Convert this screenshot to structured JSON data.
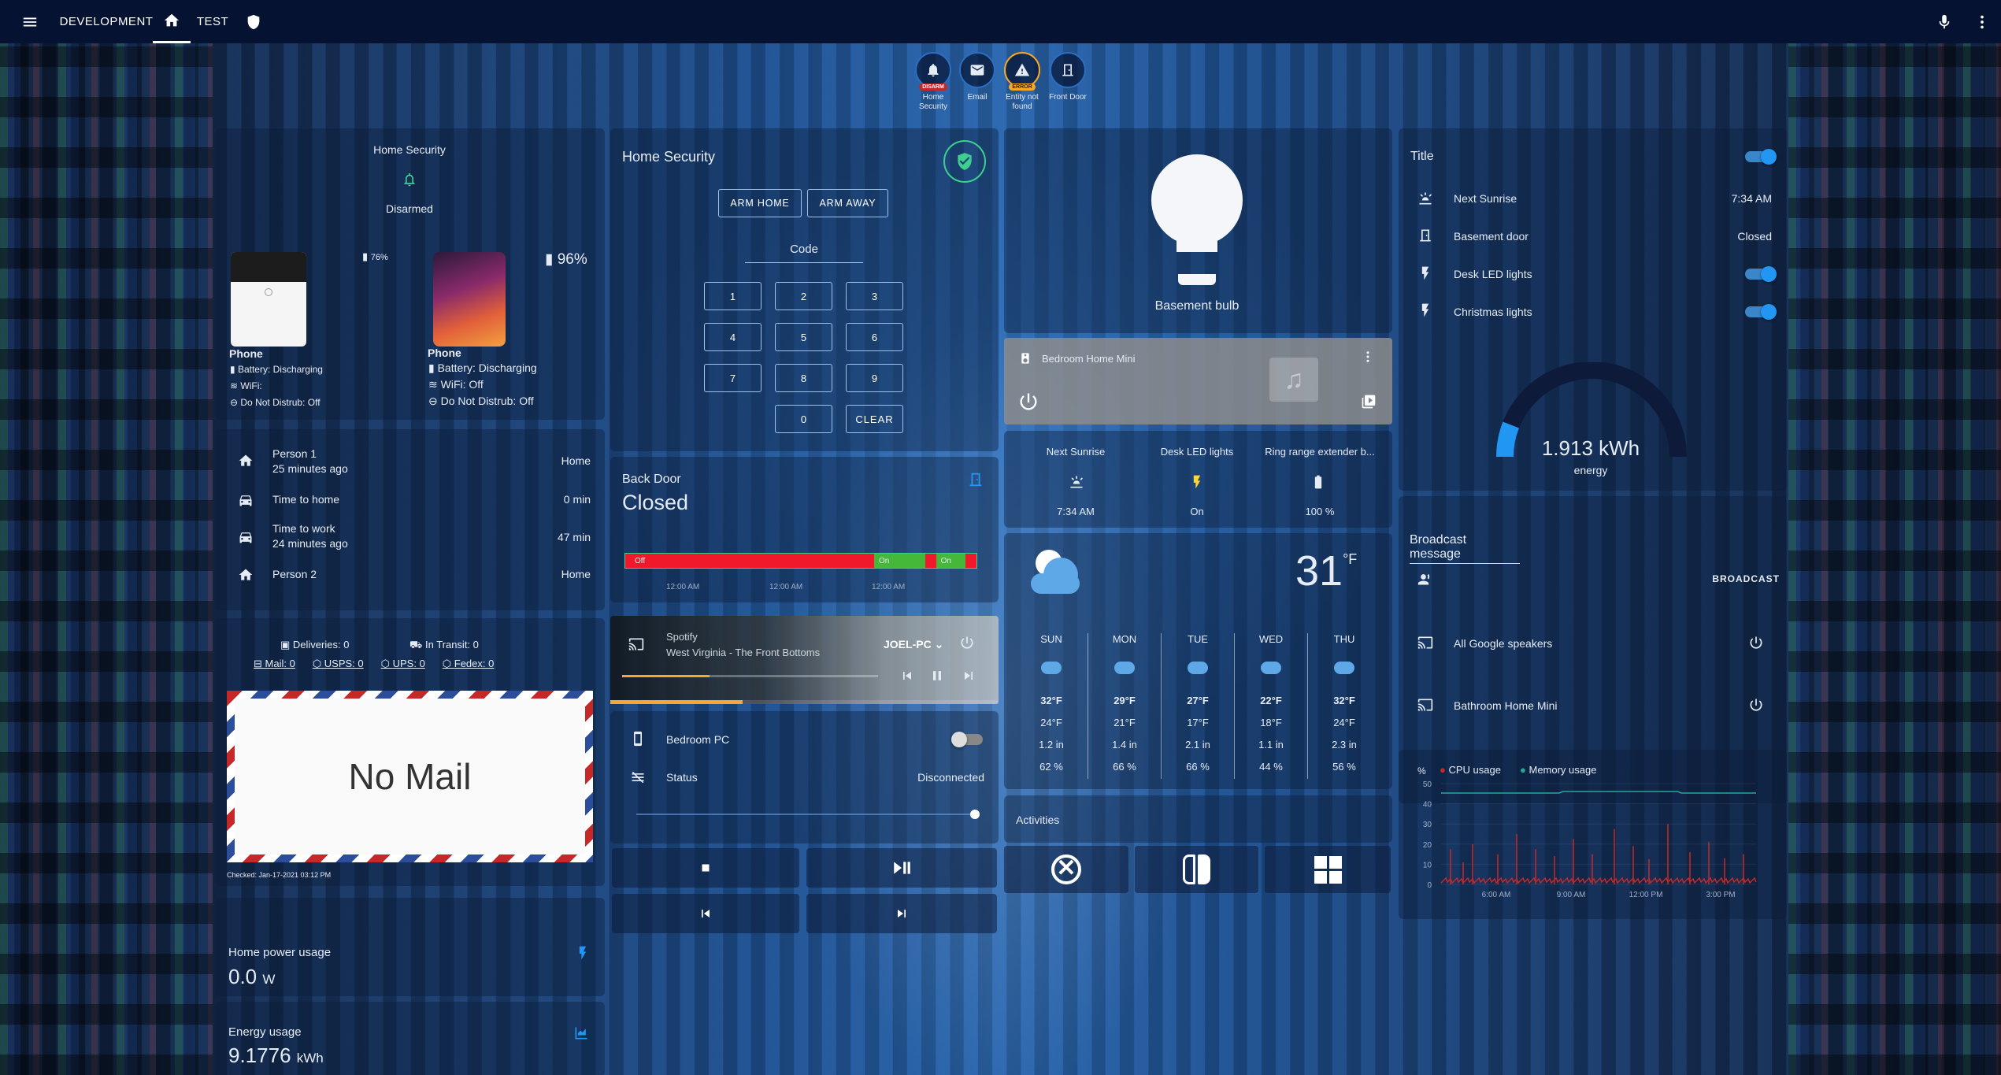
{
  "topbar": {
    "tabs": [
      "DEVELOPMENT",
      "TEST"
    ]
  },
  "badges": [
    {
      "label": "Home Security",
      "chip": "DISARM",
      "chip_color": "#c62828"
    },
    {
      "label": "Email",
      "chip": ""
    },
    {
      "label": "Entity not found",
      "chip": "ERROR",
      "chip_color": "#f9a825"
    },
    {
      "label": "Front Door",
      "chip": ""
    }
  ],
  "alarm_glance": {
    "title": "Home Security",
    "state": "Disarmed"
  },
  "phones": [
    {
      "name": "Phone",
      "battery": "76%",
      "status": "Battery: Discharging",
      "wifi": "WiFi:",
      "dnd": "Do Not Distrub: Off"
    },
    {
      "name": "Phone",
      "battery": "96%",
      "status": "Battery: Discharging",
      "wifi": "WiFi: Off",
      "dnd": "Do Not Distrub: Off"
    }
  ],
  "people": [
    {
      "name": "Person 1",
      "sub": "25 minutes ago",
      "value": "Home"
    },
    {
      "name": "Time to home",
      "sub": "",
      "value": "0 min"
    },
    {
      "name": "Time to work",
      "sub": "24 minutes ago",
      "value": "47 min"
    },
    {
      "name": "Person 2",
      "sub": "",
      "value": "Home"
    }
  ],
  "mail": {
    "deliveries": "Deliveries: 0",
    "in_transit": "In Transit: 0",
    "mail": "Mail: 0",
    "usps": "USPS: 0",
    "ups": "UPS: 0",
    "fedex": "Fedex: 0",
    "envelope": "No Mail",
    "checked": "Checked: Jan-17-2021 03:12 PM"
  },
  "power": {
    "label": "Home power usage",
    "value": "0.0",
    "unit": "W"
  },
  "energy": {
    "label": "Energy usage",
    "value": "9.1776",
    "unit": "kWh"
  },
  "alarm": {
    "title": "Home Security",
    "arm_home": "ARM HOME",
    "arm_away": "ARM AWAY",
    "code_label": "Code",
    "keys": [
      "1",
      "2",
      "3",
      "4",
      "5",
      "6",
      "7",
      "8",
      "9",
      "0"
    ],
    "clear": "CLEAR"
  },
  "back_door": {
    "label": "Back Door",
    "state": "Closed",
    "segments": [
      {
        "label": "Off",
        "fraction": 0.67
      },
      {
        "label": "On",
        "fraction": 0.13
      },
      {
        "label": "On",
        "fraction": 0.07
      }
    ],
    "times": [
      "12:00 AM",
      "12:00 AM",
      "12:00 AM"
    ]
  },
  "spotify": {
    "source": "Spotify",
    "track": "West Virginia - The Front Bottoms",
    "device": "JOEL-PC",
    "progress": 0.34
  },
  "pc": {
    "name": "Bedroom PC",
    "status_label": "Status",
    "status": "Disconnected",
    "volume": 1.0
  },
  "bulb": {
    "name": "Basement bulb"
  },
  "home_mini": {
    "name": "Bedroom Home Mini"
  },
  "glance": [
    {
      "name": "Next Sunrise",
      "value": "7:34 AM"
    },
    {
      "name": "Desk LED lights",
      "value": "On"
    },
    {
      "name": "Ring range extender b...",
      "value": "100 %"
    }
  ],
  "weather": {
    "temp": "31",
    "unit": "°F",
    "days": [
      {
        "day": "SUN",
        "high": "32°F",
        "low": "24°F",
        "precip": "1.2 in",
        "prob": "62 %"
      },
      {
        "day": "MON",
        "high": "29°F",
        "low": "21°F",
        "precip": "1.4 in",
        "prob": "66 %"
      },
      {
        "day": "TUE",
        "high": "27°F",
        "low": "17°F",
        "precip": "2.1 in",
        "prob": "66 %"
      },
      {
        "day": "WED",
        "high": "22°F",
        "low": "18°F",
        "precip": "1.1 in",
        "prob": "44 %"
      },
      {
        "day": "THU",
        "high": "32°F",
        "low": "24°F",
        "precip": "2.3 in",
        "prob": "56 %"
      }
    ]
  },
  "activities": {
    "title": "Activities"
  },
  "entities": {
    "title": "Title",
    "rows": [
      {
        "name": "Next Sunrise",
        "value": "7:34 AM"
      },
      {
        "name": "Basement door",
        "value": "Closed"
      },
      {
        "name": "Desk LED lights",
        "value": ""
      },
      {
        "name": "Christmas lights",
        "value": ""
      }
    ]
  },
  "energy_gauge": {
    "value": "1.913 kWh",
    "label": "energy",
    "fraction": 0.12
  },
  "broadcast": {
    "label": "Broadcast message",
    "button": "BROADCAST"
  },
  "speakers": [
    {
      "name": "All Google speakers"
    },
    {
      "name": "Bathroom Home Mini"
    }
  ],
  "chart_data": {
    "type": "line",
    "series": [
      {
        "name": "CPU usage",
        "color": "#c62828"
      },
      {
        "name": "Memory usage",
        "color": "#26a69a"
      }
    ],
    "ylabel": "%",
    "yticks": [
      "50",
      "40",
      "30",
      "20",
      "10",
      "0"
    ],
    "xticks": [
      "6:00 AM",
      "9:00 AM",
      "12:00 PM",
      "3:00 PM"
    ],
    "spikes": [
      [
        0.03,
        0.35
      ],
      [
        0.07,
        0.22
      ],
      [
        0.1,
        0.4
      ],
      [
        0.18,
        0.3
      ],
      [
        0.24,
        0.5
      ],
      [
        0.3,
        0.35
      ],
      [
        0.36,
        0.28
      ],
      [
        0.42,
        0.45
      ],
      [
        0.48,
        0.3
      ],
      [
        0.55,
        0.55
      ],
      [
        0.61,
        0.38
      ],
      [
        0.66,
        0.25
      ],
      [
        0.72,
        0.6
      ],
      [
        0.79,
        0.32
      ],
      [
        0.85,
        0.42
      ],
      [
        0.9,
        0.26
      ],
      [
        0.96,
        0.3
      ]
    ]
  }
}
